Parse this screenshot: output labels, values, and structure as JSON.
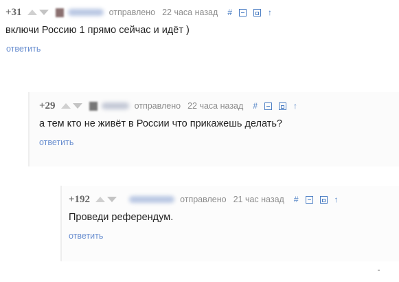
{
  "comments": [
    {
      "score": "+31",
      "sent_label": "отправлено",
      "time": "22 часа назад",
      "permalink_icon": "#",
      "parent_icon": "↑",
      "text": "включи Россию 1 прямо сейчас и идёт )",
      "reply_label": "ответить"
    },
    {
      "score": "+29",
      "sent_label": "отправлено",
      "time": "22 часа назад",
      "permalink_icon": "#",
      "parent_icon": "↑",
      "text": "а тем кто не живёт в России что прикажешь делать?",
      "reply_label": "ответить"
    },
    {
      "score": "+192",
      "sent_label": "отправлено",
      "time": "21 час назад",
      "permalink_icon": "#",
      "parent_icon": "↑",
      "text": "Проведи референдум.",
      "reply_label": "ответить"
    }
  ],
  "colors": {
    "link": "#4d7fc4",
    "reply": "#6a8fd0",
    "meta": "#8c8c8c",
    "score": "#666666",
    "text": "#222222"
  },
  "icons": {
    "upvote": "upvote-arrow-icon",
    "downvote": "downvote-arrow-icon",
    "permalink": "hash-icon",
    "collapse": "collapse-box-icon",
    "save": "save-icon",
    "parent": "arrow-up-icon"
  }
}
